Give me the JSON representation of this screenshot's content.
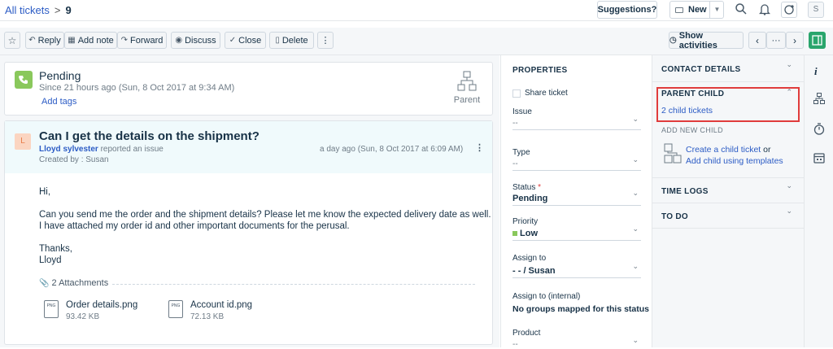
{
  "breadcrumb": {
    "link": "All tickets",
    "separator": ">",
    "ticket_id": "9"
  },
  "topbar": {
    "suggestions": "Suggestions?",
    "new_label": "New",
    "avatar_letter": "S"
  },
  "toolbar": {
    "reply": "Reply",
    "add_note": "Add note",
    "forward": "Forward",
    "discuss": "Discuss",
    "close": "Close",
    "delete": "Delete",
    "more": "⋮",
    "show_activities": "Show activities",
    "pager_more": "···"
  },
  "status_card": {
    "status": "Pending",
    "since": "Since 21 hours ago (Sun, 8 Oct 2017 at 9:34 AM)",
    "add_tags": "Add tags",
    "parent_label": "Parent"
  },
  "ticket": {
    "avatar_letter": "L",
    "subject": "Can I get the details on the shipment?",
    "requester": "Lloyd sylvester",
    "action": "reported an issue",
    "created_by": "Created by : Susan",
    "timestamp": "a day ago (Sun, 8 Oct 2017 at 6:09 AM)",
    "body": {
      "greeting": "Hi,",
      "line1": "Can you send me the order and the shipment details? Please let me know the expected delivery date as well.",
      "line2": "I have attached my order id and other important documents for the perusal.",
      "thanks": "Thanks,",
      "sign": "Lloyd"
    },
    "attachments_label": "2 Attachments",
    "attachments": [
      {
        "icon": "PNG",
        "name": "Order details.png",
        "size": "93.42 KB"
      },
      {
        "icon": "PNG",
        "name": "Account id.png",
        "size": "72.13 KB"
      }
    ]
  },
  "properties": {
    "title": "PROPERTIES",
    "share_ticket": "Share ticket",
    "issue_label": "Issue",
    "issue_value": "--",
    "type_label": "Type",
    "type_value": "--",
    "status_label": "Status",
    "required_mark": "*",
    "status_value": "Pending",
    "priority_label": "Priority",
    "priority_value": "Low",
    "assign_label": "Assign to",
    "assign_value": "- - / Susan",
    "assign_internal_label": "Assign to (internal)",
    "assign_internal_value": "No groups mapped for this status",
    "product_label": "Product",
    "product_value": "--"
  },
  "contact": {
    "contact_details": "CONTACT DETAILS",
    "parent_child": "PARENT CHILD",
    "child_tickets": "2 child tickets",
    "add_new_child": "ADD NEW CHILD",
    "create_child": "Create a child ticket",
    "or": "or",
    "add_templates": "Add child using templates",
    "time_logs": "TIME LOGS",
    "to_do": "TO DO"
  },
  "colors": {
    "accent": "#2c5cc5",
    "highlight_box": "#e03c3c",
    "status_icon": "#8ac85c",
    "priority_low": "#8ac85c",
    "rail_active": "#29a56c"
  }
}
